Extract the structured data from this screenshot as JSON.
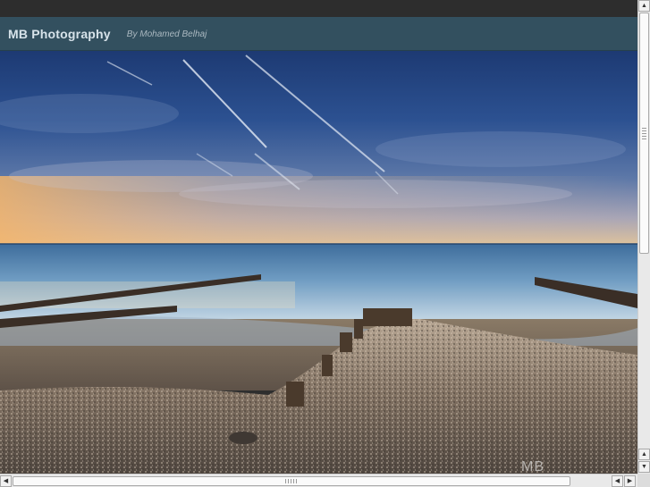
{
  "site": {
    "title": "MB Photography",
    "byline": "By Mohamed Belhaj"
  },
  "photo": {
    "subject": "beach-groynes-sunset",
    "watermark": "MB"
  },
  "scrollbars": {
    "up_glyph": "▲",
    "down_glyph": "▼",
    "left_glyph": "◀",
    "right_glyph": "▶"
  }
}
